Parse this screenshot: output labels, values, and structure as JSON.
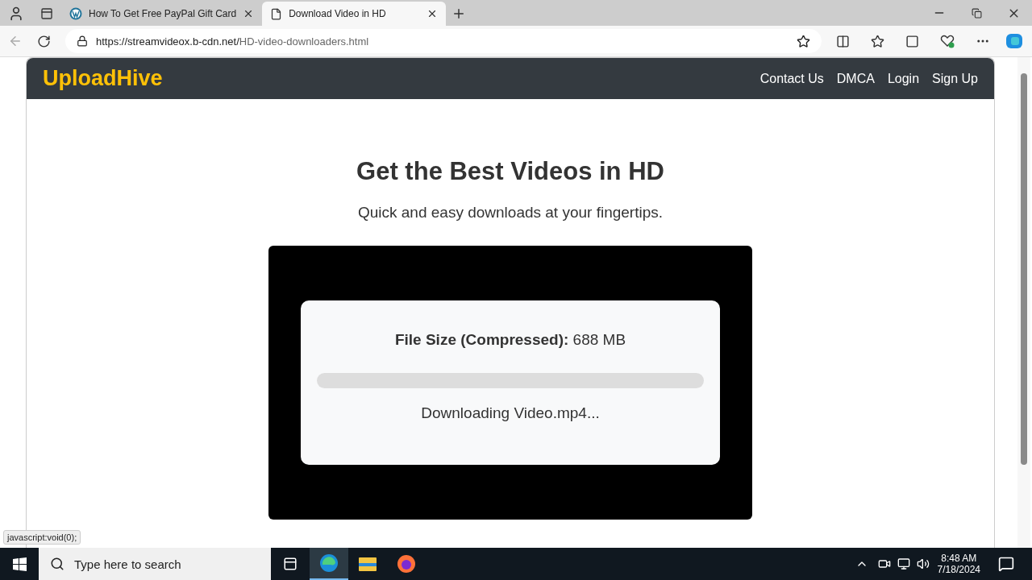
{
  "browser": {
    "tabs": [
      {
        "title": "How To Get Free PayPal Gift Card",
        "selected": false,
        "kind": "wordpress"
      },
      {
        "title": "Download Video in HD",
        "selected": true,
        "kind": "page"
      }
    ],
    "url_host": "https://streamvideox.b-cdn.net/",
    "url_path": "HD-video-downloaders.html"
  },
  "site": {
    "logo": "UploadHive",
    "nav": [
      "Contact Us",
      "DMCA",
      "Login",
      "Sign Up"
    ],
    "heading": "Get the Best Videos in HD",
    "subheading": "Quick and easy downloads at your fingertips.",
    "download": {
      "size_label": "File Size (Compressed):",
      "size_value": "688 MB",
      "level": 0,
      "status": "Downloading Video.mp4..."
    }
  },
  "status_url": "javascript:void(0);",
  "taskbar": {
    "search_placeholder": "Type here to search",
    "time": "8:48 AM",
    "date": "7/18/2024"
  }
}
